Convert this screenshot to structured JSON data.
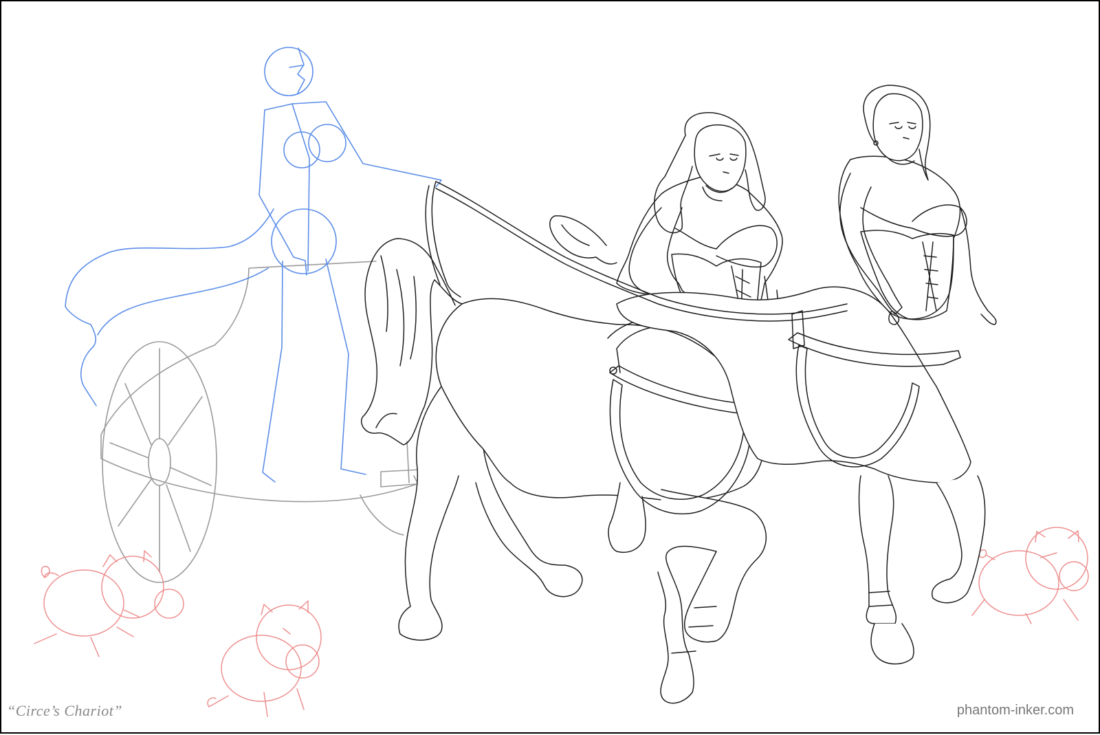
{
  "artwork": {
    "title": "“Circe’s Chariot”",
    "credit": "phantom-inker.com",
    "colors": {
      "frame": "#000000",
      "sketch_rider": "#5b8de8",
      "sketch_chariot": "#9a9a9a",
      "sketch_pigs": "#ee8f8f",
      "inks": "#1e1e1e"
    }
  }
}
